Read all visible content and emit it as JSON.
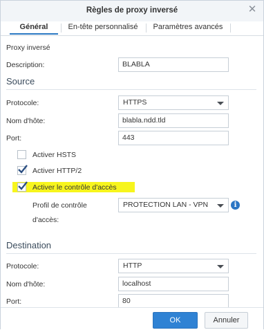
{
  "dialog": {
    "title": "Règles de proxy inversé"
  },
  "tabs": [
    {
      "label": "Général",
      "selected": true
    },
    {
      "label": "En-tête personnalisé",
      "selected": false
    },
    {
      "label": "Paramètres avancés",
      "selected": false
    }
  ],
  "general": {
    "heading": "Proxy inversé",
    "description_label": "Description:",
    "description_value": "BLABLA"
  },
  "source": {
    "title": "Source",
    "protocol_label": "Protocole:",
    "protocol_value": "HTTPS",
    "hostname_label": "Nom d'hôte:",
    "hostname_value": "blabla.ndd.tld",
    "port_label": "Port:",
    "port_value": "443",
    "hsts_label": "Activer HSTS",
    "hsts_checked": false,
    "http2_label": "Activer HTTP/2",
    "http2_checked": true,
    "access_control_label": "Activer le contrôle d'accès",
    "access_control_checked": true,
    "access_profile_label_line1": "Profil de contrôle",
    "access_profile_label_line2": "d'accès:",
    "access_profile_value": "PROTECTION LAN - VPN"
  },
  "destination": {
    "title": "Destination",
    "protocol_label": "Protocole:",
    "protocol_value": "HTTP",
    "hostname_label": "Nom d'hôte:",
    "hostname_value": "localhost",
    "port_label": "Port:",
    "port_value": "80"
  },
  "footer": {
    "ok_label": "OK",
    "cancel_label": "Annuler"
  },
  "icons": {
    "close": "close-icon",
    "info": "info-icon",
    "check": "checkmark-icon",
    "caret": "chevron-down-icon"
  },
  "colors": {
    "accent": "#2f82d4",
    "highlight": "#f7f51d",
    "checkmark": "#2c4f82"
  }
}
